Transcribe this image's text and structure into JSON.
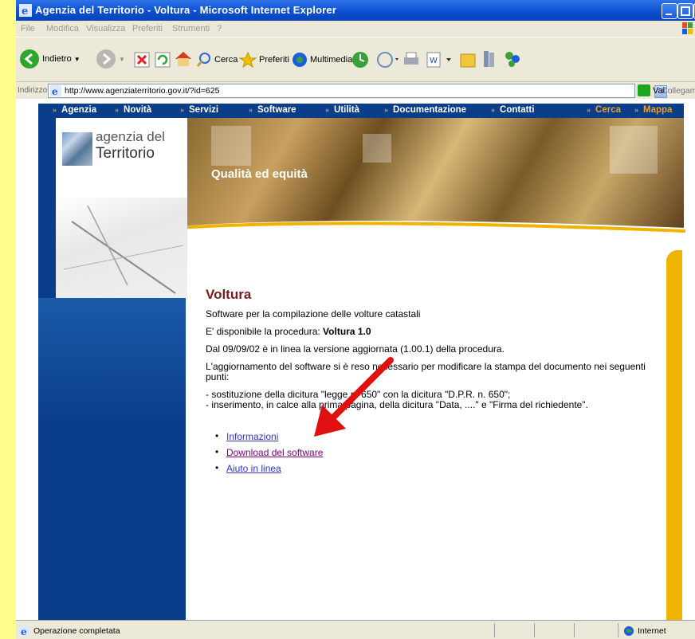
{
  "window": {
    "title": "Agenzia del Territorio - Voltura - Microsoft Internet Explorer"
  },
  "menu": [
    "File",
    "Modifica",
    "Visualizza",
    "Preferiti",
    "Strumenti",
    "?"
  ],
  "toolbar": {
    "back": "Indietro",
    "search": "Cerca",
    "favorites": "Preferiti",
    "media": "Multimedia"
  },
  "address": {
    "label": "Indirizzo",
    "url": "http://www.agenziaterritorio.gov.it/?id=625",
    "go": "Vai",
    "links": "Collegame"
  },
  "site_nav": {
    "items": [
      "Agenzia",
      "Novità",
      "Servizi",
      "Software",
      "Utilità",
      "Documentazione",
      "Contatti"
    ],
    "cerca": "Cerca",
    "mappa": "Mappa"
  },
  "logo": {
    "line1": "agenzia del",
    "line2": "Territorio"
  },
  "banner": {
    "tagline": "Qualità ed equità"
  },
  "page": {
    "heading": "Voltura",
    "subtitle": "Software per la compilazione delle volture catastali",
    "available_prefix": "E' disponibile la procedura: ",
    "available_bold": "Voltura 1.0",
    "update_line": "Dal 09/09/02 è in linea la versione aggiornata (1.00.1) della procedura.",
    "reason_line": "L'aggiornamento del software si è reso necessario per modificare la stampa del documento nei seguenti punti:",
    "point1": "- sostituzione della dicitura \"legge n. 650\" con la dicitura \"D.P.R. n. 650\";",
    "point2": "- inserimento, in calce alla prima pagina, della dicitura \"Data, ....\" e \"Firma del richiedente\".",
    "links": [
      "Informazioni",
      "Download del software",
      "Aiuto in linea"
    ]
  },
  "status": {
    "left": "Operazione completata",
    "zone": "Internet"
  },
  "colors": {
    "nav_blue": "#0a3d8a",
    "gold": "#f0b400",
    "heading": "#7a1a1a",
    "arrow": "#e01010"
  }
}
